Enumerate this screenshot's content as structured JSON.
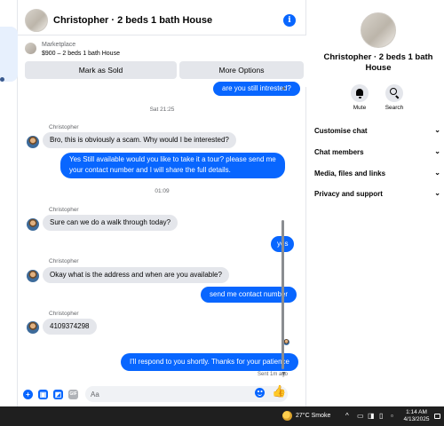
{
  "header": {
    "title": "Christopher · 2 beds 1 bath House",
    "info_icon": "info-icon"
  },
  "listing": {
    "marketplace_label": "Marketplace",
    "price_title": "$900 – 2 beds 1 bath House",
    "mark_sold_label": "Mark as Sold",
    "more_options_label": "More Options"
  },
  "messages": {
    "m0": "are you still intrested?",
    "ts1": "Sat 21:25",
    "s1": "Christopher",
    "m1": "Bro, this is obviously a scam.  Why would I be interested?",
    "m2_line1": "Yes Still available would you like to take it a tour? please send me",
    "m2_line2": "your contact number and I will share the full details.",
    "ts2": "01:09",
    "s2": "Christopher",
    "m3": "Sure can we do a walk through today?",
    "m4": "yes",
    "s3": "Christopher",
    "m5": "Okay what is the address and when are you available?",
    "m6": "send me contact number",
    "s4": "Christopher",
    "m7": "4109374298",
    "m8": "I'll respond to you shortly. Thanks for your patience",
    "sent_status": "Sent 1m ago"
  },
  "composer": {
    "placeholder": "Aa",
    "icons": [
      "plus-icon",
      "image-icon",
      "sticker-icon",
      "gif-icon",
      "emoji-icon",
      "like-icon"
    ]
  },
  "panel": {
    "title": "Christopher · 2 beds 1 bath House",
    "mute_label": "Mute",
    "search_label": "Search",
    "sections": [
      "Customise chat",
      "Chat members",
      "Media, files and links",
      "Privacy and support"
    ]
  },
  "taskbar": {
    "weather": "27°C  Smoke",
    "time": "1:14 AM",
    "date": "4/13/2025"
  },
  "colors": {
    "accent": "#0866ff",
    "incoming_bubble": "#e4e6eb",
    "taskbar": "#1f1f1f"
  }
}
